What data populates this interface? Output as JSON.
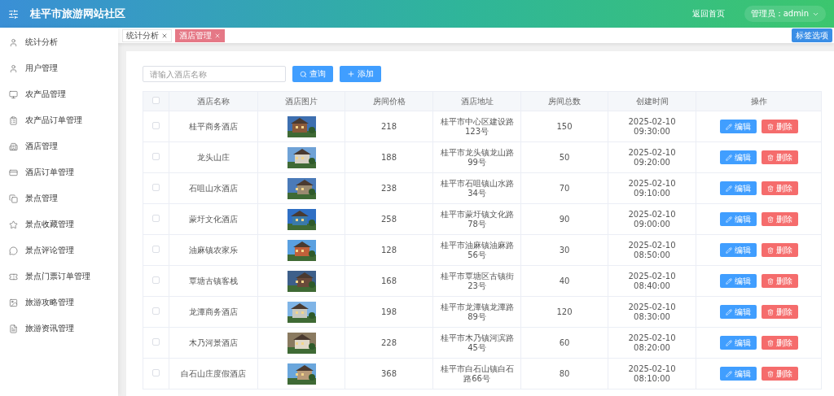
{
  "header": {
    "title": "桂平市旅游网站社区",
    "home_link": "返回首页",
    "user_menu": "管理员：admin"
  },
  "sidebar": {
    "items": [
      {
        "label": "统计分析"
      },
      {
        "label": "用户管理"
      },
      {
        "label": "农产品管理"
      },
      {
        "label": "农产品订单管理"
      },
      {
        "label": "酒店管理"
      },
      {
        "label": "酒店订单管理"
      },
      {
        "label": "景点管理"
      },
      {
        "label": "景点收藏管理"
      },
      {
        "label": "景点评论管理"
      },
      {
        "label": "景点门票订单管理"
      },
      {
        "label": "旅游攻略管理"
      },
      {
        "label": "旅游资讯管理"
      }
    ]
  },
  "tabs": [
    {
      "label": "统计分析",
      "selected": false
    },
    {
      "label": "酒店管理",
      "selected": true
    }
  ],
  "tab_options_button": "标签选项",
  "search": {
    "placeholder": "请输入酒店名称"
  },
  "buttons": {
    "query": "查询",
    "add": "添加"
  },
  "table": {
    "select_all": {
      "checked": false
    },
    "columns": [
      "酒店名称",
      "酒店图片",
      "房间价格",
      "酒店地址",
      "房间总数",
      "创建时间",
      "操作"
    ],
    "rows": [
      {
        "checked": false,
        "name": "桂平商务酒店",
        "price": "218",
        "address": "桂平市中心区建设路123号",
        "rooms": "150",
        "created": "2025-02-10 09:30:00",
        "edit": "编辑",
        "delete": "删除"
      },
      {
        "checked": false,
        "name": "龙头山庄",
        "price": "188",
        "address": "桂平市龙头镇龙山路99号",
        "rooms": "50",
        "created": "2025-02-10 09:20:00",
        "edit": "编辑",
        "delete": "删除"
      },
      {
        "checked": false,
        "name": "石咀山水酒店",
        "price": "238",
        "address": "桂平市石咀镇山水路34号",
        "rooms": "70",
        "created": "2025-02-10 09:10:00",
        "edit": "编辑",
        "delete": "删除"
      },
      {
        "checked": false,
        "name": "蒙圩文化酒店",
        "price": "258",
        "address": "桂平市蒙圩镇文化路78号",
        "rooms": "90",
        "created": "2025-02-10 09:00:00",
        "edit": "编辑",
        "delete": "删除"
      },
      {
        "checked": false,
        "name": "油麻镇农家乐",
        "price": "128",
        "address": "桂平市油麻镇油麻路56号",
        "rooms": "30",
        "created": "2025-02-10 08:50:00",
        "edit": "编辑",
        "delete": "删除"
      },
      {
        "checked": false,
        "name": "覃塘古镇客栈",
        "price": "168",
        "address": "桂平市覃塘区古镇街23号",
        "rooms": "40",
        "created": "2025-02-10 08:40:00",
        "edit": "编辑",
        "delete": "删除"
      },
      {
        "checked": false,
        "name": "龙潭商务酒店",
        "price": "198",
        "address": "桂平市龙潭镇龙潭路89号",
        "rooms": "120",
        "created": "2025-02-10 08:30:00",
        "edit": "编辑",
        "delete": "删除"
      },
      {
        "checked": false,
        "name": "木乃河景酒店",
        "price": "228",
        "address": "桂平市木乃镇河滨路45号",
        "rooms": "60",
        "created": "2025-02-10 08:20:00",
        "edit": "编辑",
        "delete": "删除"
      },
      {
        "checked": false,
        "name": "白石山庄度假酒店",
        "price": "368",
        "address": "桂平市白石山镇白石路66号",
        "rooms": "80",
        "created": "2025-02-10 08:10:00",
        "edit": "编辑",
        "delete": "删除"
      }
    ]
  }
}
